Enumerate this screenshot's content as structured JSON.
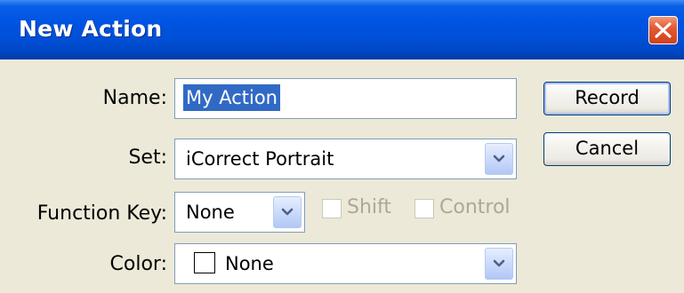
{
  "window": {
    "title": "New Action",
    "close_icon": "close-icon"
  },
  "form": {
    "name": {
      "label": "Name:",
      "value": "My Action"
    },
    "set": {
      "label": "Set:",
      "value": "iCorrect Portrait"
    },
    "function_key": {
      "label": "Function Key:",
      "value": "None",
      "shift_label": "Shift",
      "shift_checked": false,
      "shift_enabled": false,
      "control_label": "Control",
      "control_checked": false,
      "control_enabled": false
    },
    "color": {
      "label": "Color:",
      "value": "None",
      "swatch": "#ffffff"
    }
  },
  "buttons": {
    "record": "Record",
    "cancel": "Cancel"
  },
  "colors": {
    "titlebar": "#0054E3",
    "dialog_bg": "#ECE9D8",
    "selection": "#316AC5",
    "close_button": "#E35B34",
    "disabled_text": "#ACA899"
  }
}
